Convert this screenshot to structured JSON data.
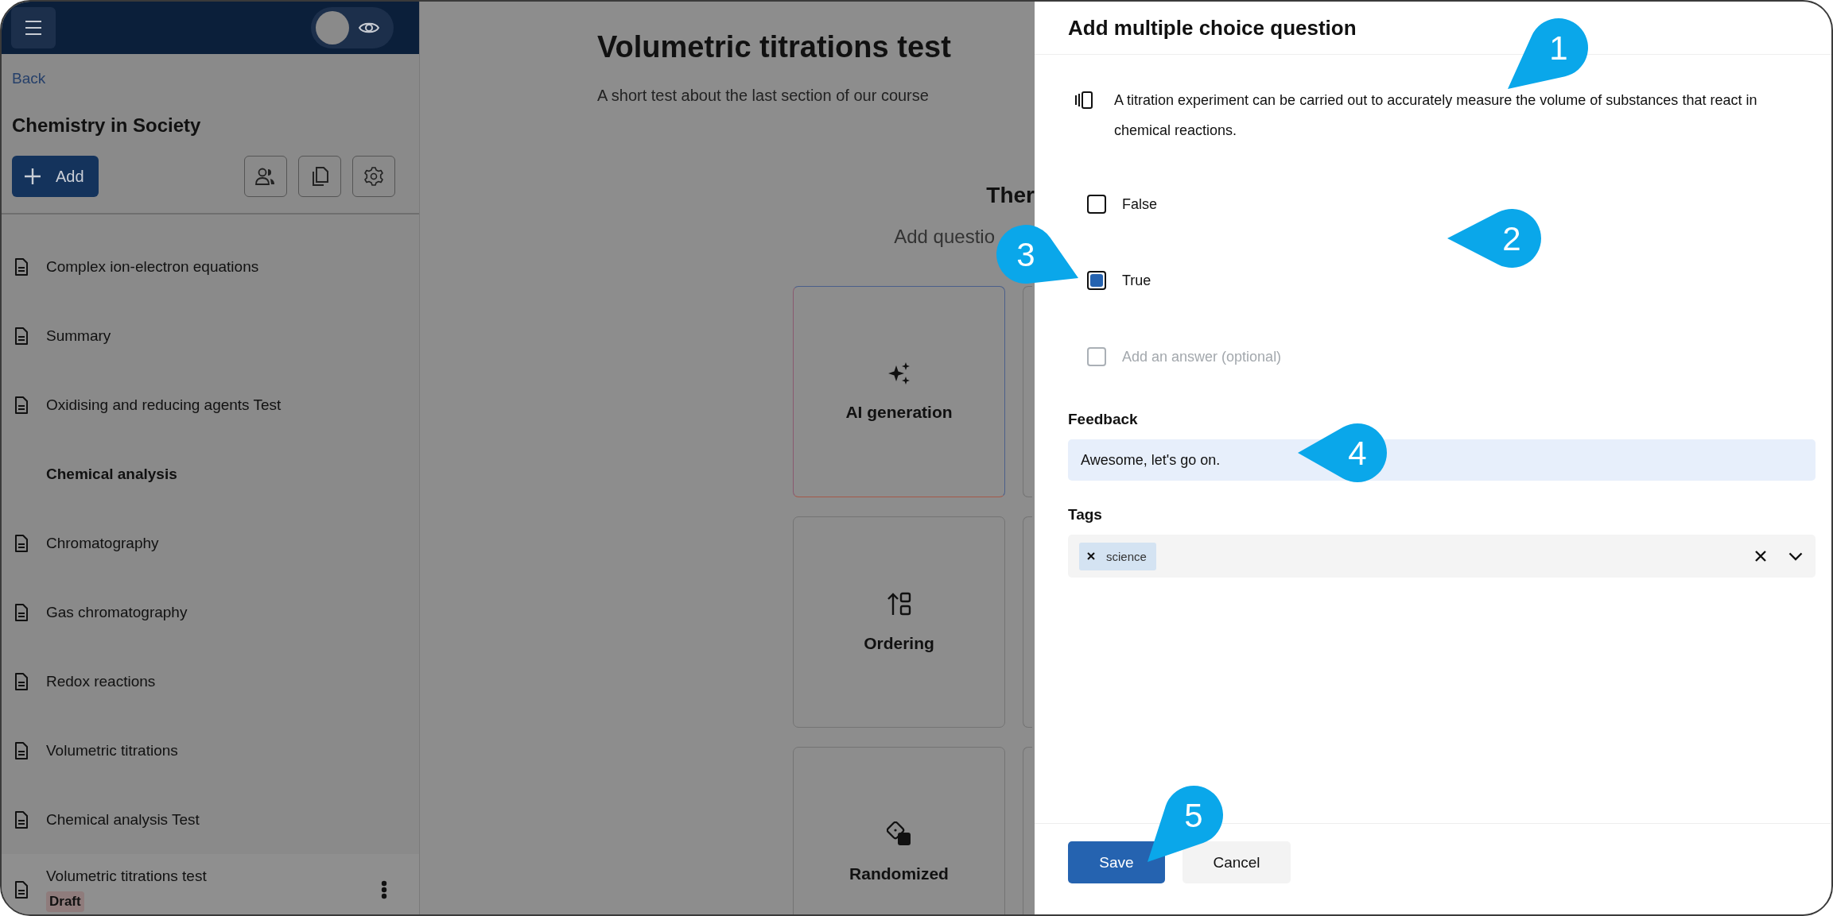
{
  "sidebar": {
    "preview_toggle": {
      "on": false
    },
    "back_link": "Back",
    "course_title": "Chemistry in Society",
    "add_button": "Add",
    "items": [
      {
        "label": "Complex ion-electron equations",
        "kind": "page",
        "selected": false
      },
      {
        "label": "Summary",
        "kind": "page",
        "selected": false
      },
      {
        "label": "Oxidising and reducing agents Test",
        "kind": "page",
        "selected": false
      },
      {
        "label": "Chemical analysis",
        "kind": "section",
        "selected": false
      },
      {
        "label": "Chromatography",
        "kind": "page",
        "selected": false
      },
      {
        "label": "Gas chromatography",
        "kind": "page",
        "selected": false
      },
      {
        "label": "Redox reactions",
        "kind": "page",
        "selected": false
      },
      {
        "label": "Volumetric titrations",
        "kind": "page",
        "selected": false
      },
      {
        "label": "Chemical analysis Test",
        "kind": "page",
        "selected": false
      },
      {
        "label": "Volumetric titrations test",
        "kind": "page",
        "selected": true,
        "badge": "Draft"
      }
    ]
  },
  "main": {
    "title": "Volumetric titrations test",
    "subtitle": "A short test about the last section of our course",
    "empty_heading": "Ther",
    "empty_hint": "Add questio",
    "cards": [
      {
        "label": "AI generation",
        "kind": "ai"
      },
      {
        "kind": "blank"
      },
      {
        "label": "Ordering",
        "kind": "ordering"
      },
      {
        "kind": "blank"
      },
      {
        "label": "Randomized",
        "kind": "randomized"
      },
      {
        "kind": "blank"
      }
    ]
  },
  "panel": {
    "title": "Add multiple choice question",
    "question": "A titration experiment can be carried out to accurately measure the volume of substances that react in chemical reactions.",
    "answers": [
      {
        "label": "False",
        "checked": false
      },
      {
        "label": "True",
        "checked": true
      }
    ],
    "new_answer": {
      "placeholder": "Add an answer (optional)",
      "checked": false
    },
    "feedback": {
      "label": "Feedback",
      "value": "Awesome, let's go on."
    },
    "tags": {
      "label": "Tags",
      "items": [
        "science"
      ]
    },
    "buttons": {
      "save": "Save",
      "cancel": "Cancel"
    }
  },
  "callouts": [
    {
      "label": "1"
    },
    {
      "label": "2"
    },
    {
      "label": "3"
    },
    {
      "label": "4"
    },
    {
      "label": "5"
    }
  ]
}
